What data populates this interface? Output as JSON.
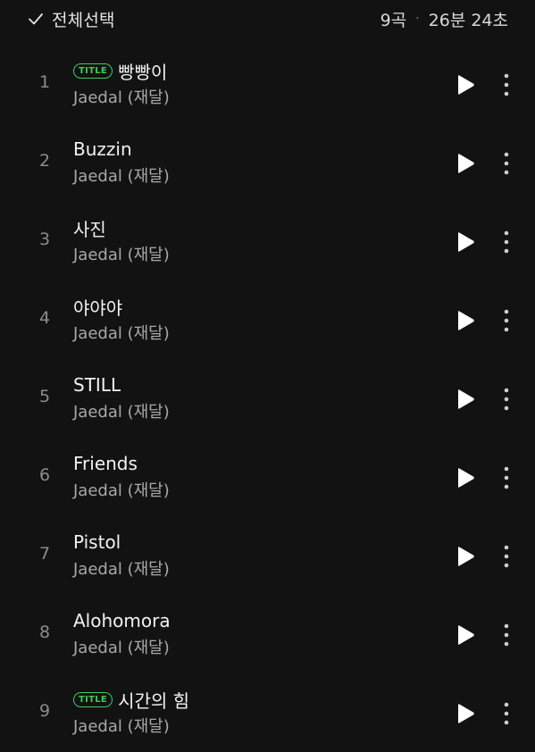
{
  "header": {
    "select_all_label": "전체선택",
    "track_count": "9곡",
    "separator": "·",
    "total_duration": "26분 24초"
  },
  "colors": {
    "background": "#121212",
    "accent": "#3fca5a",
    "primary_text": "#f2f2f2",
    "secondary_text": "#a8a8a8"
  },
  "tracks": [
    {
      "rank": "1",
      "title": "빵빵이",
      "artist": "Jaedal (재달)",
      "badge": "TITLE"
    },
    {
      "rank": "2",
      "title": "Buzzin",
      "artist": "Jaedal (재달)",
      "badge": ""
    },
    {
      "rank": "3",
      "title": "사진",
      "artist": "Jaedal (재달)",
      "badge": ""
    },
    {
      "rank": "4",
      "title": "야야야",
      "artist": "Jaedal (재달)",
      "badge": ""
    },
    {
      "rank": "5",
      "title": "STILL",
      "artist": "Jaedal (재달)",
      "badge": ""
    },
    {
      "rank": "6",
      "title": "Friends",
      "artist": "Jaedal (재달)",
      "badge": ""
    },
    {
      "rank": "7",
      "title": "Pistol",
      "artist": "Jaedal (재달)",
      "badge": ""
    },
    {
      "rank": "8",
      "title": "Alohomora",
      "artist": "Jaedal (재달)",
      "badge": ""
    },
    {
      "rank": "9",
      "title": "시간의 힘",
      "artist": "Jaedal (재달)",
      "badge": "TITLE"
    }
  ],
  "icons": {
    "check": "check-icon",
    "play": "play-icon",
    "more": "more-vertical-icon"
  }
}
